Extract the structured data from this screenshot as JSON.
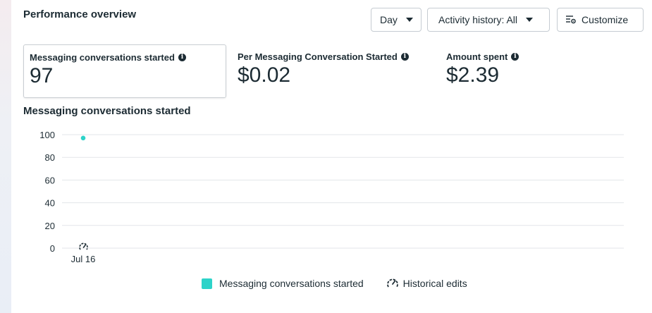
{
  "header": {
    "title": "Performance overview",
    "day_label": "Day",
    "activity_label": "Activity history: All",
    "customize_label": "Customize"
  },
  "metrics": [
    {
      "label": "Messaging conversations started",
      "value": "97",
      "selected": true
    },
    {
      "label": "Per Messaging Conversation Started",
      "value": "$0.02",
      "selected": false
    },
    {
      "label": "Amount spent",
      "value": "$2.39",
      "selected": false
    }
  ],
  "colors": {
    "series": "#2dd3c9",
    "grid": "#e3e6e9",
    "text": "#1c2b33"
  },
  "icons": {
    "info": "info-icon",
    "caret": "caret-down-icon",
    "customize": "customize-icon",
    "historical": "historical-edits-icon"
  },
  "chart_data": {
    "type": "scatter",
    "title": "Messaging conversations started",
    "x": [
      "Jul 16"
    ],
    "series": [
      {
        "name": "Messaging conversations started",
        "values": [
          97
        ]
      }
    ],
    "ylim": [
      0,
      100
    ],
    "yticks": [
      0,
      20,
      40,
      60,
      80,
      100
    ],
    "grid": true,
    "legend": [
      "Messaging conversations started",
      "Historical edits"
    ],
    "legend_placement": "bottom-center"
  }
}
